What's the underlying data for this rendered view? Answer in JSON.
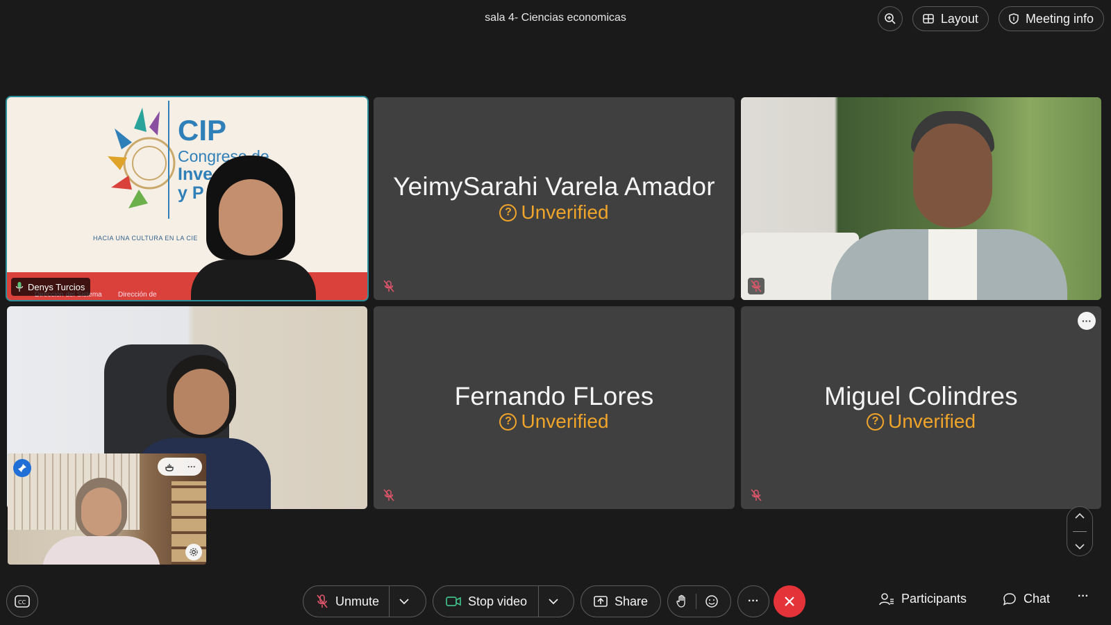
{
  "meeting": {
    "title": "sala 4- Ciencias economicas"
  },
  "toolbar_top": {
    "layout_label": "Layout",
    "meeting_info_label": "Meeting info"
  },
  "tiles": [
    {
      "name": "Denys Turcios",
      "type": "video",
      "active": true,
      "slide_text": {
        "brand": "CIP",
        "line1": "Congreso de",
        "line2": "Inve",
        "line3": "y P",
        "tagline": "HACIA UNA CULTURA EN LA CIE",
        "footer1": "Dirección del Sistema",
        "footer2": "Dirección de"
      }
    },
    {
      "name": "YeimySarahi Varela Amador",
      "status": "Unverified",
      "type": "avatar",
      "muted": true
    },
    {
      "name": "",
      "type": "video",
      "muted": true
    },
    {
      "name": "",
      "type": "video"
    },
    {
      "name": "Fernando FLores",
      "status": "Unverified",
      "type": "avatar",
      "muted": true
    },
    {
      "name": "Miguel Colindres",
      "status": "Unverified",
      "type": "avatar",
      "muted": true
    }
  ],
  "self_view": {
    "type": "video"
  },
  "controls": {
    "unmute_label": "Unmute",
    "stop_video_label": "Stop video",
    "share_label": "Share",
    "participants_label": "Participants",
    "chat_label": "Chat"
  },
  "colors": {
    "background": "#1a1a1a",
    "tile": "#404040",
    "unverified": "#f0a52a",
    "end_call": "#e5333a",
    "active_border": "#2a8f9a"
  }
}
